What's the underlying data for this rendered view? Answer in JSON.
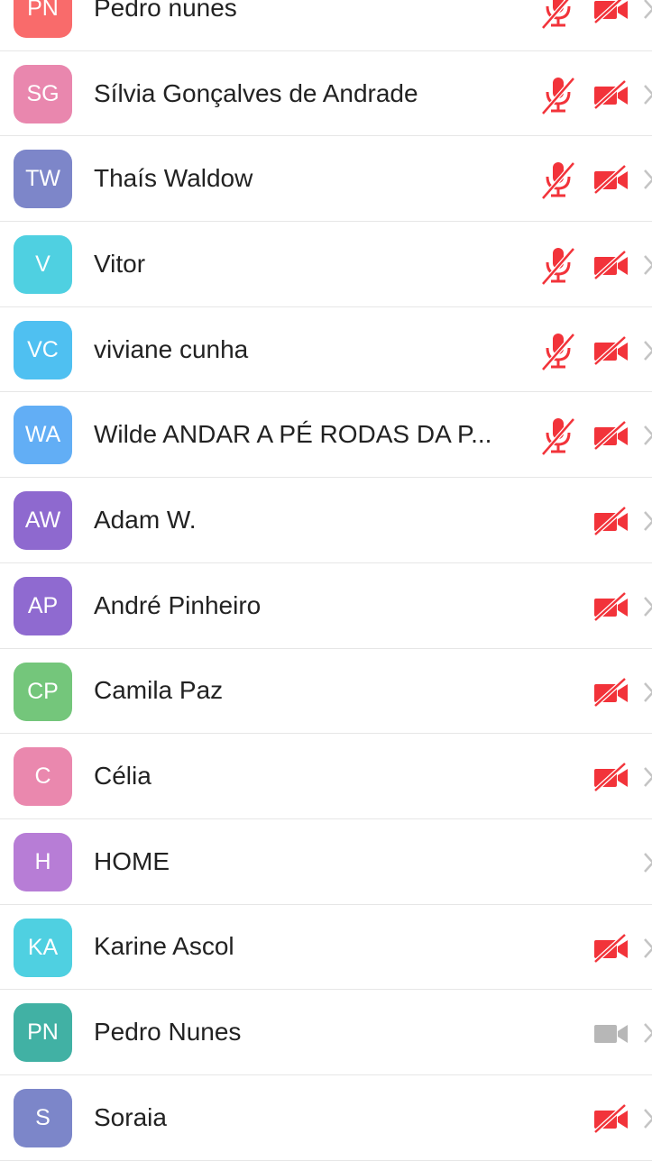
{
  "colors": {
    "muted_red": "#f2333a",
    "camera_on_gray": "#b7b7b7",
    "chevron_gray": "#c4c4c4",
    "divider": "#e6e6e6"
  },
  "participants": [
    {
      "initials": "PN",
      "name": "Pedro nunes",
      "avatar_color": "#f96b6b",
      "mic": "muted",
      "camera": "off"
    },
    {
      "initials": "SG",
      "name": "Sílvia Gonçalves de Andrade",
      "avatar_color": "#e987ae",
      "mic": "muted",
      "camera": "off"
    },
    {
      "initials": "TW",
      "name": "Thaís Waldow",
      "avatar_color": "#7d86c9",
      "mic": "muted",
      "camera": "off"
    },
    {
      "initials": "V",
      "name": "Vitor",
      "avatar_color": "#4fd0e1",
      "mic": "muted",
      "camera": "off"
    },
    {
      "initials": "VC",
      "name": "viviane cunha",
      "avatar_color": "#4fc0f1",
      "mic": "muted",
      "camera": "off"
    },
    {
      "initials": "WA",
      "name": "Wilde ANDAR A PÉ RODAS DA P...",
      "avatar_color": "#62aef5",
      "mic": "muted",
      "camera": "off"
    },
    {
      "initials": "AW",
      "name": "Adam W.",
      "avatar_color": "#8e69cf",
      "mic": "none",
      "camera": "off"
    },
    {
      "initials": "AP",
      "name": "André Pinheiro",
      "avatar_color": "#8f6ad0",
      "mic": "none",
      "camera": "off"
    },
    {
      "initials": "CP",
      "name": "Camila Paz",
      "avatar_color": "#74c67b",
      "mic": "none",
      "camera": "off"
    },
    {
      "initials": "C",
      "name": "Célia",
      "avatar_color": "#ea88ae",
      "mic": "none",
      "camera": "off"
    },
    {
      "initials": "H",
      "name": "HOME",
      "avatar_color": "#b77dd6",
      "mic": "none",
      "camera": "none"
    },
    {
      "initials": "KA",
      "name": "Karine Ascol",
      "avatar_color": "#4fd0e1",
      "mic": "none",
      "camera": "off"
    },
    {
      "initials": "PN",
      "name": "Pedro Nunes",
      "avatar_color": "#41b1a4",
      "mic": "none",
      "camera": "on"
    },
    {
      "initials": "S",
      "name": "Soraia",
      "avatar_color": "#7c86c9",
      "mic": "none",
      "camera": "off"
    }
  ]
}
